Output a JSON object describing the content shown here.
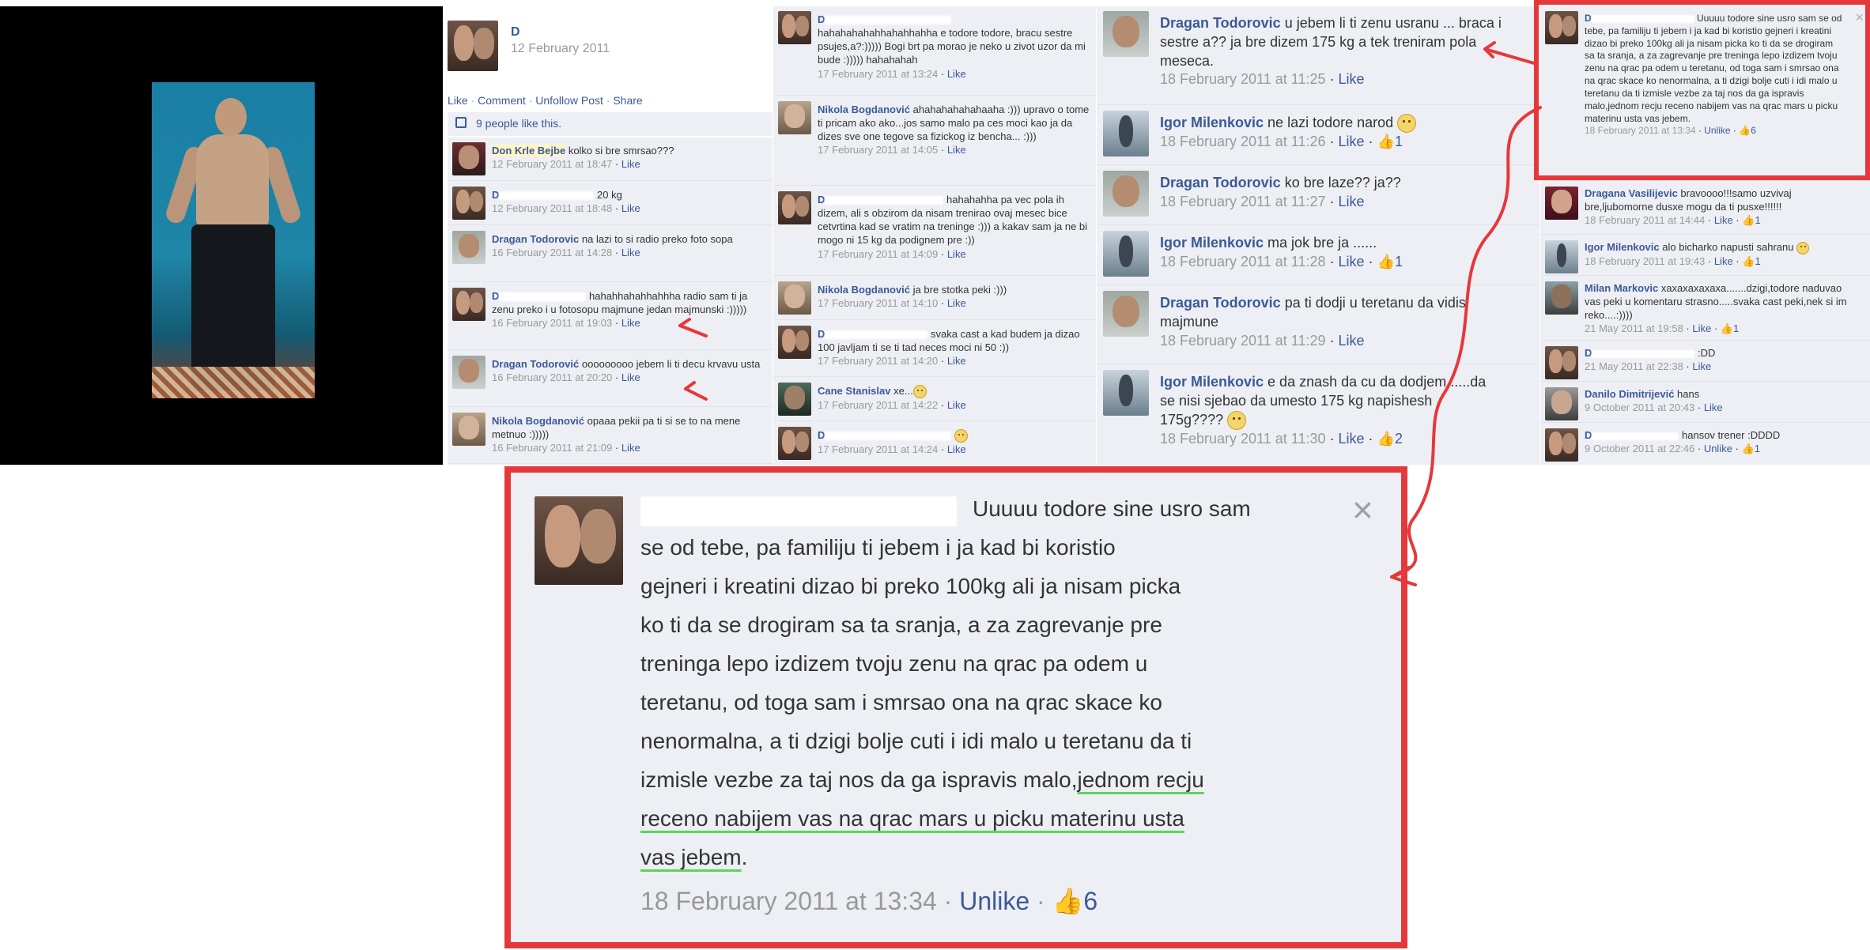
{
  "panel1": {
    "author": "D",
    "date": "12 February 2011",
    "actions": [
      "Like",
      "Comment",
      "Unfollow Post",
      "Share"
    ],
    "likes_text": "9 people like this.",
    "comments": [
      {
        "name": "Don Krle Bejbe",
        "text": "kolko si bre smrsao???",
        "date": "12 February 2011 at 18:47",
        "action": "Like"
      },
      {
        "name": "D",
        "text": "20 kg",
        "date": "12 February 2011 at 18:48",
        "action": "Like"
      },
      {
        "name": "Dragan Todorovic",
        "text": "na lazi to si radio preko foto sopa",
        "date": "16 February 2011 at 14:28",
        "action": "Like"
      },
      {
        "name": "D",
        "text": "hahahhahahhahhha radio sam ti ja zenu preko i u fotosopu majmune jedan majmunski :)))))",
        "date": "16 February 2011 at 19:03",
        "action": "Like"
      },
      {
        "name": "Dragan Todorović",
        "text": "ooooooooo jebem li ti decu krvavu usta",
        "date": "16 February 2011 at 20:20",
        "action": "Like"
      },
      {
        "name": "Nikola Bogdanović",
        "text": "opaaa pekii pa ti si se to na mene metnuo :)))))",
        "date": "16 February 2011 at 21:09",
        "action": "Like"
      }
    ]
  },
  "panel2": {
    "comments": [
      {
        "name": "D",
        "text": "hahahahahahhahahhahha e todore todore, bracu sestre psujes,a?:))))) Bogi brt pa morao je neko u zivot uzor da mi bude :))))) hahahahah",
        "date": "17 February 2011 at 13:24",
        "action": "Like"
      },
      {
        "name": "Nikola Bogdanović",
        "text": "ahahahahahahaaha :))) upravo o tome ti pricam ako ako...jos samo malo pa ces moci kao ja da dizes sve one tegove sa fizickog iz bencha... :)))",
        "date": "17 February 2011 at 14:05",
        "action": "Like"
      },
      {
        "name": "D",
        "text": "hahahahha pa vec pola ih dizem, ali s obzirom da nisam trenirao ovaj mesec bice cetvrtina kad se vratim na treninge :))) a kakav sam ja ne bi mogo ni 15 kg da podignem pre :))",
        "date": "17 February 2011 at 14:09",
        "action": "Like"
      },
      {
        "name": "Nikola Bogdanović",
        "text": "ja bre stotka peki :)))",
        "date": "17 February 2011 at 14:10",
        "action": "Like"
      },
      {
        "name": "D",
        "text": "svaka cast a kad budem ja dizao 100 javljam ti se ti tad neces moci ni 50 :))",
        "date": "17 February 2011 at 14:20",
        "action": "Like"
      },
      {
        "name": "Cane Stanislav",
        "text": "xe...",
        "date": "17 February 2011 at 14:22",
        "action": "Like"
      },
      {
        "name": "D",
        "text": "",
        "date": "17 February 2011 at 14:24",
        "action": "Like"
      }
    ]
  },
  "panel3": {
    "comments": [
      {
        "name": "Dragan Todorovic",
        "text": "u jebem li ti zenu usranu ... braca i sestre a?? ja bre dizem 175 kg a tek treniram pola meseca.",
        "date": "18 February 2011 at 11:25",
        "action": "Like",
        "likes": ""
      },
      {
        "name": "Igor Milenkovic",
        "text": "ne lazi todore narod",
        "date": "18 February 2011 at 11:26",
        "action": "Like",
        "likes": "1"
      },
      {
        "name": "Dragan Todorovic",
        "text": "ko bre laze?? ja??",
        "date": "18 February 2011 at 11:27",
        "action": "Like",
        "likes": ""
      },
      {
        "name": "Igor Milenkovic",
        "text": "ma jok bre ja ......",
        "date": "18 February 2011 at 11:28",
        "action": "Like",
        "likes": "1"
      },
      {
        "name": "Dragan Todorovic",
        "text": "pa ti dodji u teretanu da vidis majmune",
        "date": "18 February 2011 at 11:29",
        "action": "Like",
        "likes": ""
      },
      {
        "name": "Igor Milenkovic",
        "text": "e da znash da cu da dodjem......da se nisi sjebao da umesto 175 kg napishesh 175g????",
        "date": "18 February 2011 at 11:30",
        "action": "Like",
        "likes": "2"
      }
    ]
  },
  "panel4": {
    "comments": [
      {
        "name": "D",
        "text": "Uuuuu todore sine usro sam se od tebe, pa familiju ti jebem i ja kad bi koristio gejneri i kreatini dizao bi preko 100kg ali ja nisam picka ko ti da se drogiram sa ta sranja, a za zagrevanje pre treninga lepo izdizem tvoju zenu na qrac pa odem u teretanu, od toga sam i smrsao ona na qrac skace ko nenormalna, a ti dzigi bolje cuti i idi malo u teretanu da ti izmisle vezbe za taj nos da ga ispravis malo,jednom recju receno nabijem vas na qrac mars u picku materinu usta vas jebem.",
        "date": "18 February 2011 at 13:34",
        "action": "Unlike",
        "likes": "6"
      },
      {
        "name": "Dragana Vasilijevic",
        "text": "bravoooo!!!samo uzvivaj bre,ljubomorne dusxe mogu da ti pusxe!!!!!!",
        "date": "18 February 2011 at 14:44",
        "action": "Like",
        "likes": "1"
      },
      {
        "name": "Igor Milenkovic",
        "text": "alo bicharko napusti sahranu",
        "date": "18 February 2011 at 19:43",
        "action": "Like",
        "likes": "1"
      },
      {
        "name": "Milan Markovic",
        "text": "xaxaxaxaxaxa.......dzigi,todore naduvao vas peki u komentaru strasno.....svaka cast peki,nek si im reko....:))))",
        "date": "21 May 2011 at 19:58",
        "action": "Like",
        "likes": "1"
      },
      {
        "name": "D",
        "text": ":DD",
        "date": "21 May 2011 at 22:38",
        "action": "Like",
        "likes": ""
      },
      {
        "name": "Danilo Dimitrijević",
        "text": "hans",
        "date": "9 October 2011 at 20:43",
        "action": "Like",
        "likes": ""
      },
      {
        "name": "D",
        "text": "hansov trener :DDDD",
        "date": "9 October 2011 at 22:46",
        "action": "Unlike",
        "likes": "1"
      }
    ]
  },
  "zoom": {
    "line1": "Uuuuu todore sine usro sam",
    "lines": [
      "se od tebe, pa familiju ti jebem i ja kad bi koristio",
      "gejneri i kreatini dizao bi preko 100kg ali ja nisam picka",
      "ko ti da se drogiram sa ta sranja, a za zagrevanje pre",
      "treninga lepo izdizem tvoju zenu na qrac pa odem u",
      "teretanu, od toga sam i smrsao ona na qrac skace ko",
      "nenormalna, a ti dzigi bolje cuti i idi malo u teretanu da ti"
    ],
    "line8a": "izmisle vezbe za taj nos da ga ispravis malo,",
    "line8b": "jednom recju",
    "line9": "receno nabijem vas na qrac mars u picku materinu usta",
    "line10": "vas jebem",
    "line10end": ".",
    "date": "18 February 2011 at 13:34",
    "action": "Unlike",
    "likes": "6",
    "close": "×"
  },
  "colors": {
    "accent": "#e5383b",
    "link": "#3b5998",
    "underline": "#5bd45b"
  }
}
